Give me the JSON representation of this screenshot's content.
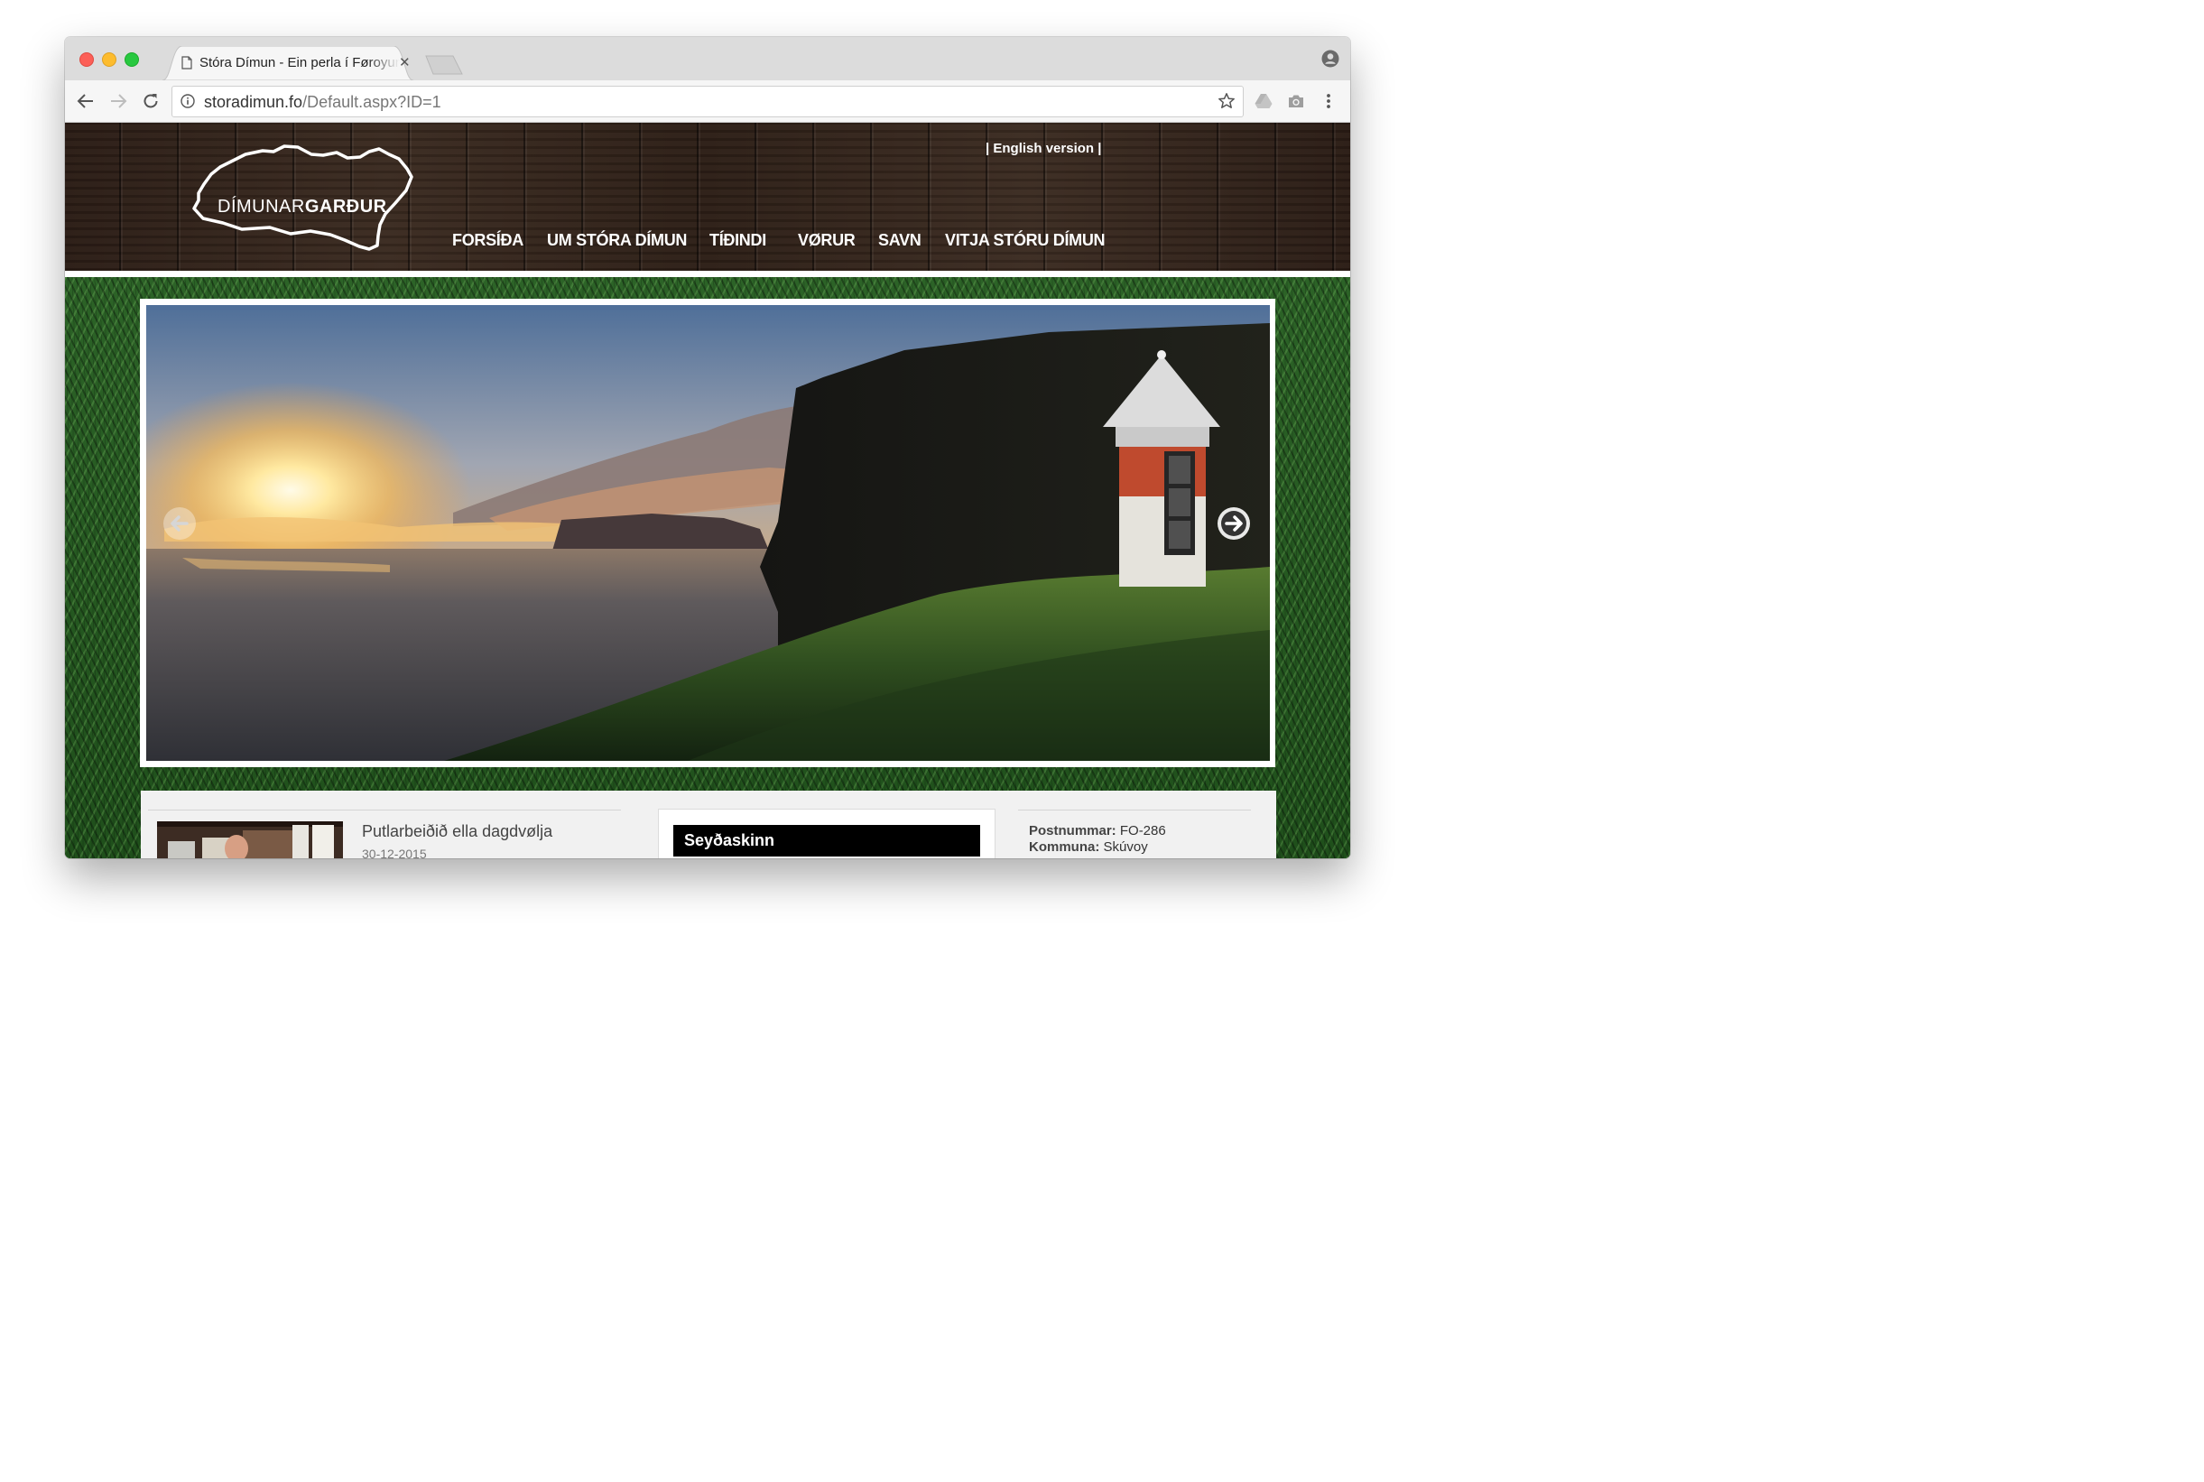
{
  "browser": {
    "tab_title": "Stóra Dímun - Ein perla í Føroyum",
    "url_host": "storadimun.fo",
    "url_path": "/Default.aspx?ID=1",
    "icons": [
      "document-icon",
      "close-icon",
      "back-icon",
      "forward-icon",
      "reload-icon",
      "info-icon",
      "star-icon",
      "drive-icon",
      "camera-icon",
      "menu-icon",
      "profile-icon"
    ]
  },
  "site": {
    "logo": "DÍMUNARGARÐUR",
    "logo_light": "DÍMUNAR",
    "logo_bold": "GARÐUR",
    "lang_link": "| English version |",
    "nav": [
      "FORSÍÐA",
      "UM STÓRA DÍMUN",
      "TÍÐINDI",
      "VØRUR",
      "SAVN",
      "VITJA STÓRU DÍMUN"
    ]
  },
  "slider": {
    "image": "Sunset over the sea with a sea cliff and a red-and-white lighthouse",
    "prev_icon": "arrow-left-icon",
    "next_icon": "arrow-right-icon"
  },
  "news": {
    "title": "Putlarbeiðið ella dagdvølja",
    "date": "30-12-2015"
  },
  "box": {
    "heading": "Seyðaskinn"
  },
  "address": {
    "postcode_label": "Postnummar:",
    "postcode_value": "FO-286",
    "municipality_label": "Kommuna:",
    "municipality_value": "Skúvoy"
  },
  "colors": {
    "header_wood": "#2b1d16",
    "grass": "#24591f",
    "panel": "#f1f1f1",
    "heading_bg": "#000000"
  }
}
